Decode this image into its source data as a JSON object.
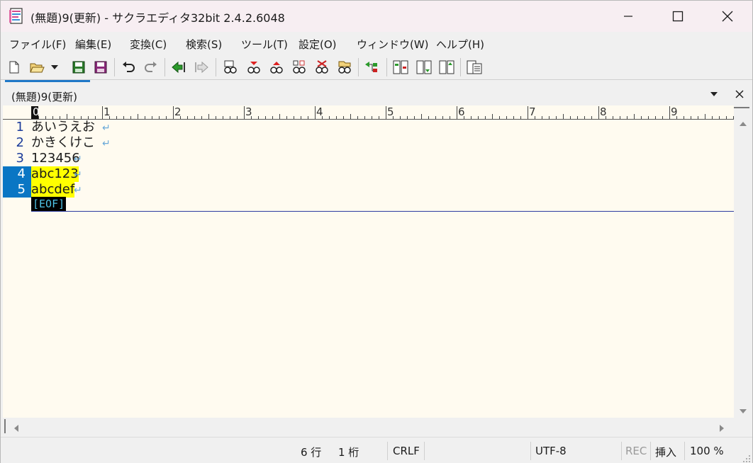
{
  "window": {
    "title": "(無題)9(更新) - サクラエディタ32bit 2.4.2.6048",
    "minimize_icon": "minimize-icon",
    "maximize_icon": "maximize-icon",
    "close_icon": "close-icon"
  },
  "menu": {
    "items": [
      "ファイル(F)",
      "編集(E)",
      "変換(C)",
      "検索(S)",
      "ツール(T)",
      "設定(O)",
      "ウィンドウ(W)",
      "ヘルプ(H)"
    ]
  },
  "toolbar": {
    "buttons": [
      "new-file-icon",
      "open-file-icon",
      "open-dropdown-icon",
      "save-icon",
      "save-all-icon",
      "undo-icon",
      "redo-icon",
      "move-prev-icon",
      "move-next-icon",
      "search-icon",
      "search-prev-icon",
      "search-next-icon",
      "replace-icon",
      "clear-mark-icon",
      "grep-icon",
      "outline-icon",
      "compare-icon",
      "compare-next-icon",
      "compare-prev-icon",
      "window-list-icon"
    ]
  },
  "tabs": {
    "active_label": "(無題)9(更新)"
  },
  "ruler": {
    "marks": [
      "0",
      "1",
      "2",
      "3",
      "4",
      "5",
      "6",
      "7",
      "8",
      "9"
    ]
  },
  "editor": {
    "lines": [
      {
        "num": "1",
        "text": "あいうえお",
        "selected": false
      },
      {
        "num": "2",
        "text": "かきくけこ",
        "selected": false
      },
      {
        "num": "3",
        "text": "123456",
        "selected": false
      },
      {
        "num": "4",
        "text": "abc123",
        "selected": true
      },
      {
        "num": "5",
        "text": "abcdef",
        "selected": true
      }
    ],
    "newline_mark": "↵",
    "eof_mark": "[EOF]"
  },
  "status": {
    "row": "6 行",
    "col": "1 桁",
    "eol": "CRLF",
    "encoding": "UTF-8",
    "rec": "REC",
    "mode": "挿入",
    "zoom": "100 %"
  },
  "colors": {
    "selection_gutter": "#0a76c4",
    "highlight": "#ffff00",
    "editor_bg": "#fffbf0",
    "line_number": "#1c3c9a"
  }
}
